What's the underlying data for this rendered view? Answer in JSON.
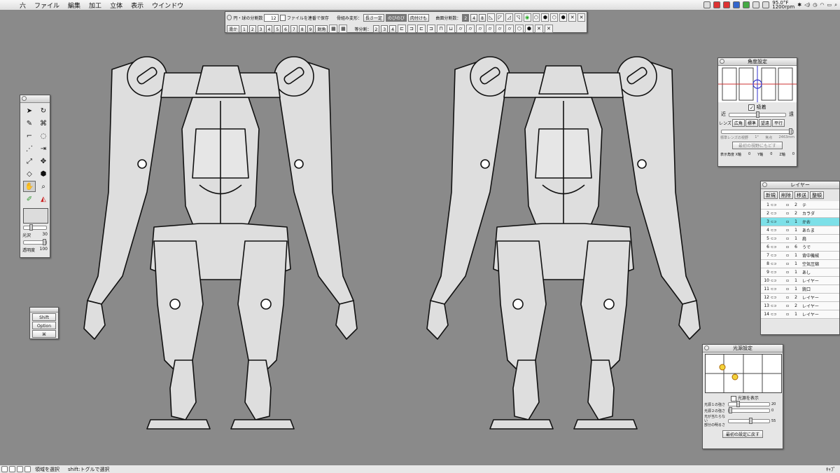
{
  "menubar": {
    "app_name": "六",
    "items": [
      "ファイル",
      "編集",
      "加工",
      "立体",
      "表示",
      "ウインドウ"
    ],
    "status_temp": "95.0°F",
    "status_rpm": "1200rpm"
  },
  "toolbar": {
    "circle_label": "円・球の分割数",
    "circle_value": "12",
    "save_label": "ファイルを連番で保存",
    "bone_label": "骨組み変形：",
    "bone_opt1": "長さ一定",
    "bone_opt2": "のびのび",
    "bone_opt3": "肉付けも",
    "curve_label": "曲面分割数：",
    "curve_opts": [
      "2",
      "4",
      "8"
    ],
    "row2_first": "滑か",
    "row2_nums": [
      "1",
      "2",
      "3",
      "4",
      "5",
      "6",
      "7",
      "8",
      "9"
    ],
    "row2_after": "鋭角",
    "equal_label": "等分割：",
    "equal_opts": [
      "2",
      "3",
      "4"
    ]
  },
  "tools": {
    "gloss_label": "光沢",
    "gloss_value": "30",
    "gloss_level": 0.3,
    "opacity_label": "透明度",
    "opacity_value": "100",
    "opacity_level": 1.0
  },
  "keys": {
    "shift": "Shift",
    "option": "Option",
    "command": "⌘"
  },
  "angle_panel": {
    "title": "角度設定",
    "snap_label": "吸着",
    "near": "近",
    "far": "遠",
    "lens_label": "レンズ",
    "lens_buttons": [
      "広角",
      "標準",
      "望遠",
      "平行"
    ],
    "lens_info_1": "標準レンズの視野",
    "lens_info_2": "1°",
    "lens_info_3": "焦点",
    "lens_info_4": "2463mm",
    "reset_label": "最初の視野にもどす",
    "axis_label": "表示角度 X軸",
    "x_val": "0",
    "y_label": "Y軸",
    "y_val": "0",
    "z_label": "Z軸",
    "z_val": "0"
  },
  "layer_panel": {
    "title": "レイヤー",
    "buttons": [
      "新規",
      "削除",
      "移送",
      "整頓"
    ],
    "rows": [
      {
        "n": "1",
        "c": "2",
        "name": "テ"
      },
      {
        "n": "2",
        "c": "2",
        "name": "カラダ"
      },
      {
        "n": "3",
        "c": "1",
        "name": "かお"
      },
      {
        "n": "4",
        "c": "1",
        "name": "あたま"
      },
      {
        "n": "5",
        "c": "1",
        "name": "肩"
      },
      {
        "n": "6",
        "c": "6",
        "name": "うで"
      },
      {
        "n": "7",
        "c": "1",
        "name": "背中機械"
      },
      {
        "n": "8",
        "c": "1",
        "name": "空気圧縮"
      },
      {
        "n": "9",
        "c": "1",
        "name": "あし"
      },
      {
        "n": "10",
        "c": "1",
        "name": "レイヤー"
      },
      {
        "n": "11",
        "c": "1",
        "name": "銃口"
      },
      {
        "n": "12",
        "c": "2",
        "name": "レイヤー"
      },
      {
        "n": "13",
        "c": "2",
        "name": "レイヤー"
      },
      {
        "n": "14",
        "c": "1",
        "name": "レイヤー"
      }
    ]
  },
  "light_panel": {
    "title": "光源設定",
    "show_label": "光源を表示",
    "light1_label": "光源１の強さ",
    "light1_value": "20",
    "light1_level": 0.2,
    "light2_label": "光源２の強さ",
    "light2_value": "0",
    "light2_level": 0.0,
    "shadow_label_1": "光が当たらない",
    "shadow_label_2": "部分の明るさ",
    "shadow_value": "55",
    "shadow_level": 0.55,
    "reset_label": "最初の設定に戻す"
  },
  "statusbar": {
    "mode": "領域を選択",
    "hint": "shift:トグルで選択",
    "right_label": "ｷｬﾌﾟ"
  },
  "colors": {
    "canvas": "#8a8a8a",
    "model_fill": "#dedede",
    "model_line": "#111111",
    "selected_layer": "#7de0e8"
  }
}
